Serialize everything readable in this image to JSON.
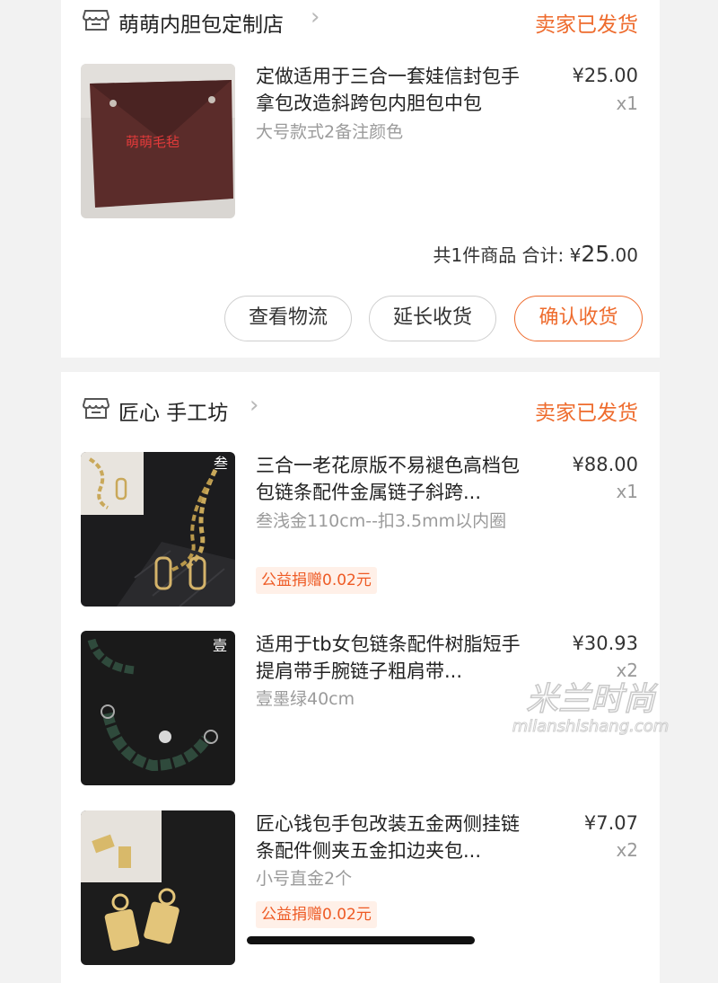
{
  "orders": [
    {
      "shop_name": "萌萌内胆包定制店",
      "status": "卖家已发货",
      "items": [
        {
          "title": "定做适用于三合一套娃信封包手拿包改造斜跨包内胆包中包",
          "sku": "大号款式2备注颜色",
          "price": "¥25.00",
          "qty": "x1",
          "image_text": "萌萌毛毡"
        }
      ],
      "total_label": "共1件商品 合计: ¥",
      "total_big": "25",
      "total_small": ".00",
      "buttons": [
        "查看物流",
        "延长收货",
        "确认收货"
      ]
    },
    {
      "shop_name": "匠心 手工坊",
      "status": "卖家已发货",
      "items": [
        {
          "title": "三合一老花原版不易褪色高档包包链条配件金属链子斜跨...",
          "sku": "叁浅金110cm--扣3.5mm以内圈",
          "price": "¥88.00",
          "qty": "x1",
          "badge": "公益捐赠0.02元",
          "image_mark": "叁"
        },
        {
          "title": "适用于tb女包链条配件树脂短手提肩带手腕链子粗肩带...",
          "sku": "壹墨绿40cm",
          "price": "¥30.93",
          "qty": "x2",
          "image_mark": "壹"
        },
        {
          "title": "匠心钱包手包改装五金两侧挂链条配件侧夹五金扣边夹包...",
          "sku": "小号直金2个",
          "price": "¥7.07",
          "qty": "x2",
          "badge": "公益捐赠0.02元"
        }
      ]
    }
  ],
  "watermark": {
    "line1": "米兰时尚",
    "line2": "milanshishang.com"
  },
  "colors": {
    "accent": "#ee6b2d",
    "badge_bg": "#fff0e8",
    "page_bg": "#f2f2f2"
  }
}
